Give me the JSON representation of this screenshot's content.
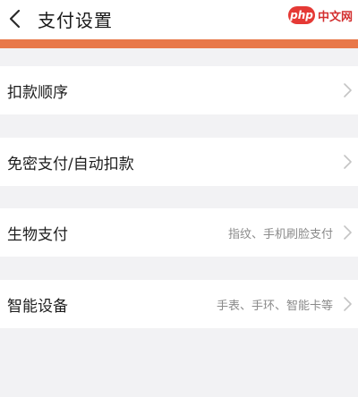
{
  "header": {
    "title": "支付设置",
    "back_icon": "chevron-left-icon"
  },
  "watermark": {
    "logo": "php",
    "text": "中文网"
  },
  "colors": {
    "accent": "#e8784a",
    "background": "#f2f2f4"
  },
  "settings": [
    {
      "label": "扣款顺序",
      "value": "",
      "icon": "chevron-right-icon"
    },
    {
      "label": "免密支付/自动扣款",
      "value": "",
      "icon": "chevron-right-icon"
    },
    {
      "label": "生物支付",
      "value": "指纹、手机刷脸支付",
      "icon": "chevron-right-icon"
    },
    {
      "label": "智能设备",
      "value": "手表、手环、智能卡等",
      "icon": "chevron-right-icon"
    }
  ]
}
